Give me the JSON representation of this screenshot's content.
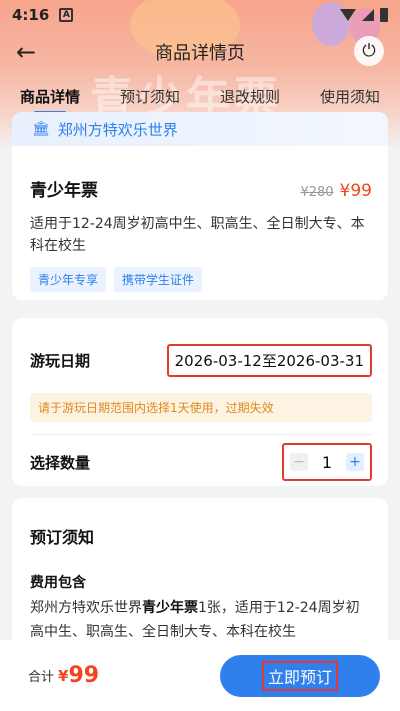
{
  "status_bar": {
    "time": "4:16",
    "notif_icon": "A"
  },
  "header": {
    "title": "商品详情页",
    "back_icon": "arrow-left-icon",
    "power_icon": "power-icon"
  },
  "banner": {
    "deco_text": "青少年票"
  },
  "tabs": [
    {
      "label": "商品详情",
      "active": true
    },
    {
      "label": "预订须知",
      "active": false
    },
    {
      "label": "退改规则",
      "active": false
    },
    {
      "label": "使用须知",
      "active": false
    }
  ],
  "product": {
    "venue": "郑州方特欢乐世界",
    "name": "青少年票",
    "old_price": "¥280",
    "price": "¥99",
    "description": "适用于12-24周岁初高中生、职高生、全日制大专、本科在校生",
    "tags": [
      "青少年专享",
      "携带学生证件"
    ]
  },
  "booking": {
    "date_label": "游玩日期",
    "date_range": "2026-03-12至2026-03-31",
    "hint": "请于游玩日期范围内选择1天使用，过期失效",
    "qty_label": "选择数量",
    "qty_minus": "−",
    "qty_value": "1",
    "qty_plus": "+"
  },
  "notice": {
    "title": "预订须知",
    "fee_title": "费用包含",
    "fee_prefix": "郑州方特欢乐世界",
    "fee_bold": "青少年票",
    "fee_suffix": "1张，适用于12-24周岁初高中生、职高生、全日制大专、本科在校生"
  },
  "footer": {
    "total_label": "合计",
    "currency": "¥",
    "total_value": "99",
    "book_label": "立即预订"
  },
  "colors": {
    "accent": "#2f80ed",
    "price": "#f2451f",
    "highlight_border": "#e53935"
  }
}
